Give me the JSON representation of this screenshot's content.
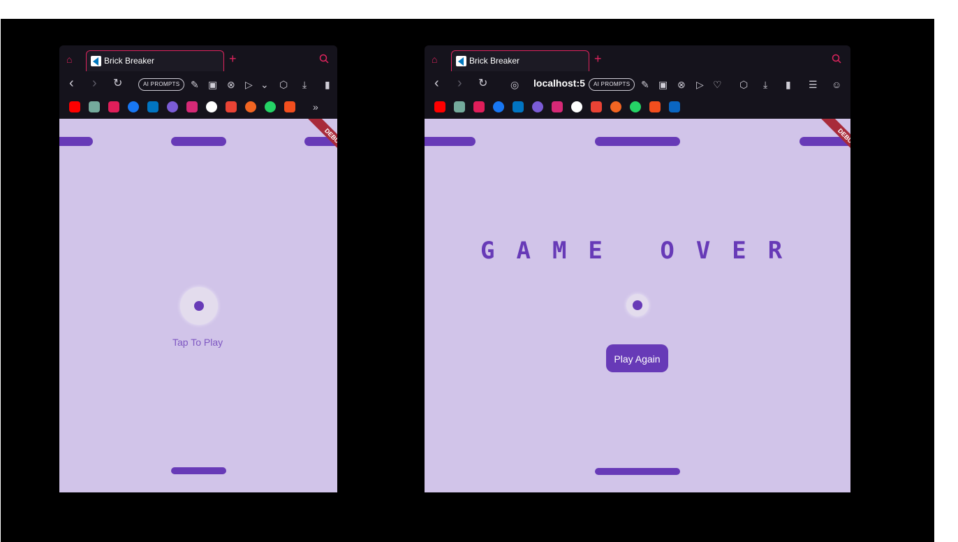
{
  "left_window": {
    "tab_title": "Brick Breaker",
    "ai_prompts_label": "AI PROMPTS",
    "hint_text": "Tap To Play",
    "debug_label": "DEBUG",
    "overflow_icon": "»"
  },
  "right_window": {
    "tab_title": "Brick Breaker",
    "url": "localhost:5",
    "ai_prompts_label": "AI PROMPTS",
    "game_over_text": "GAME OVER",
    "play_again_label": "Play Again",
    "debug_label": "DEBUG"
  },
  "icons": {
    "gamepad": "gamepad-icon",
    "new_tab": "+",
    "search": "search-icon",
    "back": "‹",
    "forward": "›",
    "reload": "↻"
  },
  "colors": {
    "game_bg": "#d1c4e9",
    "accent": "#673ab7",
    "tab_border": "#e0245e"
  },
  "bookmarks": [
    "youtube",
    "chatgpt",
    "slack",
    "facebook",
    "dart",
    "gitlab",
    "instagram",
    "github",
    "gmail",
    "todoist",
    "whatsapp",
    "figma",
    "linkedin"
  ]
}
